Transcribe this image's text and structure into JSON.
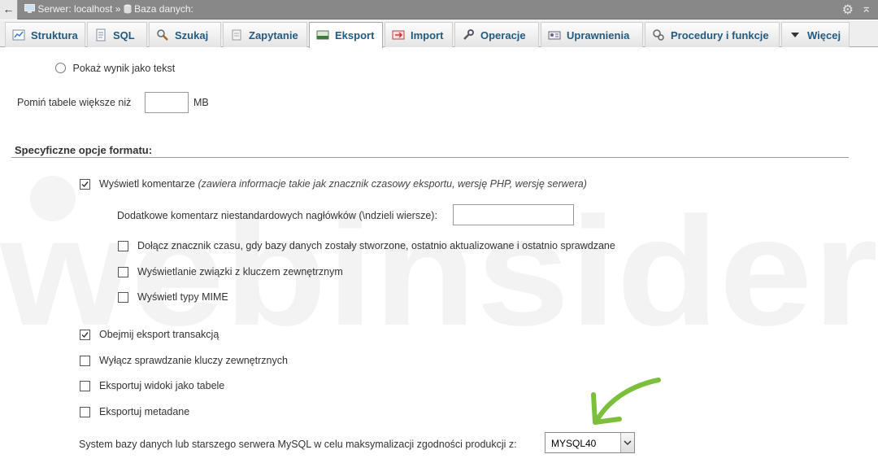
{
  "topbar": {
    "back_icon": "arrow-left-icon",
    "server_label": "Serwer: localhost",
    "separator": "»",
    "database_label": "Baza danych:",
    "gear_icon": "gear-icon",
    "collapse_icon": "collapse-up-icon"
  },
  "tabs": [
    {
      "label": "Struktura",
      "icon": "structure-icon"
    },
    {
      "label": "SQL",
      "icon": "sql-icon"
    },
    {
      "label": "Szukaj",
      "icon": "search-icon"
    },
    {
      "label": "Zapytanie",
      "icon": "query-icon"
    },
    {
      "label": "Eksport",
      "icon": "export-icon",
      "active": true
    },
    {
      "label": "Import",
      "icon": "import-icon"
    },
    {
      "label": "Operacje",
      "icon": "wrench-icon"
    },
    {
      "label": "Uprawnienia",
      "icon": "privileges-icon"
    },
    {
      "label": "Procedury i funkcje",
      "icon": "routines-icon"
    },
    {
      "label": "Więcej",
      "icon": "triangle-down-icon"
    }
  ],
  "output": {
    "show_as_text_label": "Pokaż wynik jako tekst",
    "skip_tables_label": "Pomiń tabele większe niż",
    "skip_tables_value": "",
    "skip_tables_unit": "MB"
  },
  "format_options": {
    "section_title": "Specyficzne opcje formatu:",
    "display_comments_label": "Wyświetl komentarze",
    "display_comments_desc": "(zawiera informacje takie jak znacznik czasowy eksportu, wersję PHP, wersję serwera)",
    "display_comments_checked": true,
    "custom_header_label": "Dodatkowe komentarz niestandardowych nagłówków (\\ndzieli wiersze):",
    "custom_header_value": "",
    "sub_options": [
      {
        "label": "Dołącz znacznik czasu, gdy bazy danych zostały stworzone, ostatnio aktualizowane i ostatnio sprawdzane",
        "checked": false
      },
      {
        "label": "Wyświetlanie związki z kluczem zewnętrznym",
        "checked": false
      },
      {
        "label": "Wyświetl typy MIME",
        "checked": false
      }
    ],
    "options": [
      {
        "label": "Obejmij eksport transakcją",
        "checked": true
      },
      {
        "label": "Wyłącz sprawdzanie kluczy zewnętrznych",
        "checked": false
      },
      {
        "label": "Eksportuj widoki jako tabele",
        "checked": false
      },
      {
        "label": "Eksportuj metadane",
        "checked": false
      }
    ],
    "compat_label": "System bazy danych lub starszego serwera MySQL w celu maksymalizacji zgodności produkcji z:",
    "compat_value": "MYSQL40"
  },
  "watermark_text": "webinsider",
  "colors": {
    "tab_text": "#235a81",
    "arrow": "#7cbf3c",
    "topbar": "#888888"
  }
}
